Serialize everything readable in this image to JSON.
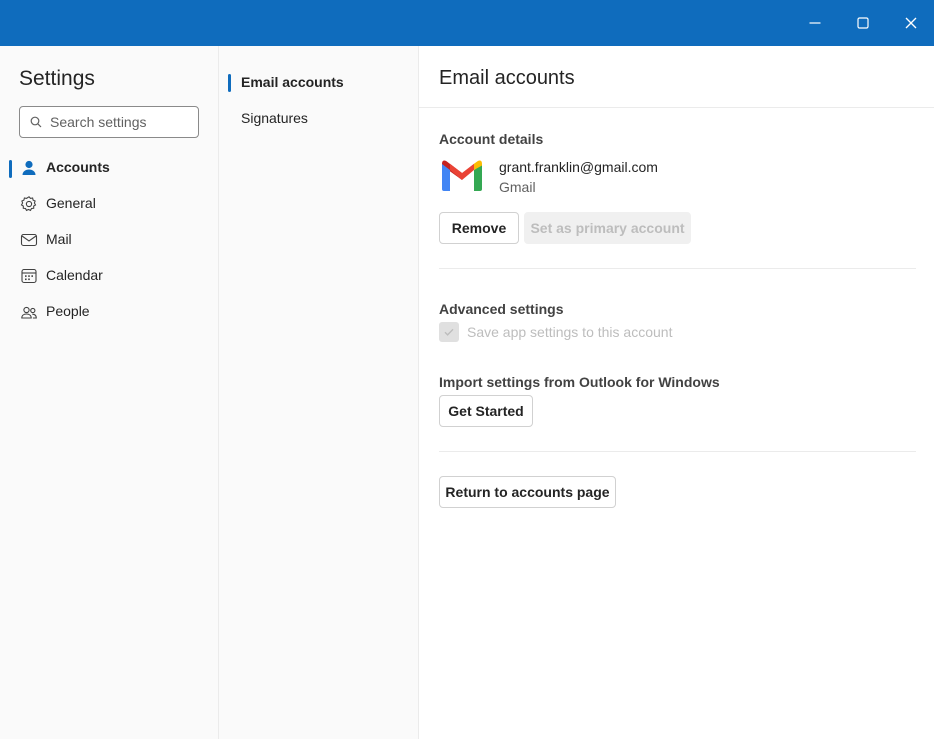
{
  "window": {
    "minimize_icon": "minimize-icon",
    "maximize_icon": "maximize-icon",
    "close_icon": "close-icon",
    "titlebar_color": "#0f6cbd"
  },
  "sidebar": {
    "title": "Settings",
    "search_placeholder": "Search settings",
    "items": [
      {
        "label": "Accounts",
        "icon": "person-icon",
        "active": true
      },
      {
        "label": "General",
        "icon": "gear-icon",
        "active": false
      },
      {
        "label": "Mail",
        "icon": "mail-icon",
        "active": false
      },
      {
        "label": "Calendar",
        "icon": "calendar-icon",
        "active": false
      },
      {
        "label": "People",
        "icon": "people-icon",
        "active": false
      }
    ]
  },
  "subnav": {
    "items": [
      {
        "label": "Email accounts",
        "active": true
      },
      {
        "label": "Signatures",
        "active": false
      }
    ]
  },
  "main": {
    "title": "Email accounts",
    "account_details": {
      "heading": "Account details",
      "email": "grant.franklin@gmail.com",
      "provider": "Gmail",
      "provider_icon": "gmail-logo-icon",
      "remove_label": "Remove",
      "set_primary_label": "Set as primary account"
    },
    "advanced": {
      "heading": "Advanced settings",
      "save_settings_label": "Save app settings to this account",
      "save_settings_checked": true
    },
    "import": {
      "heading": "Import settings from Outlook for Windows",
      "button_label": "Get Started"
    },
    "return_label": "Return to accounts page"
  }
}
